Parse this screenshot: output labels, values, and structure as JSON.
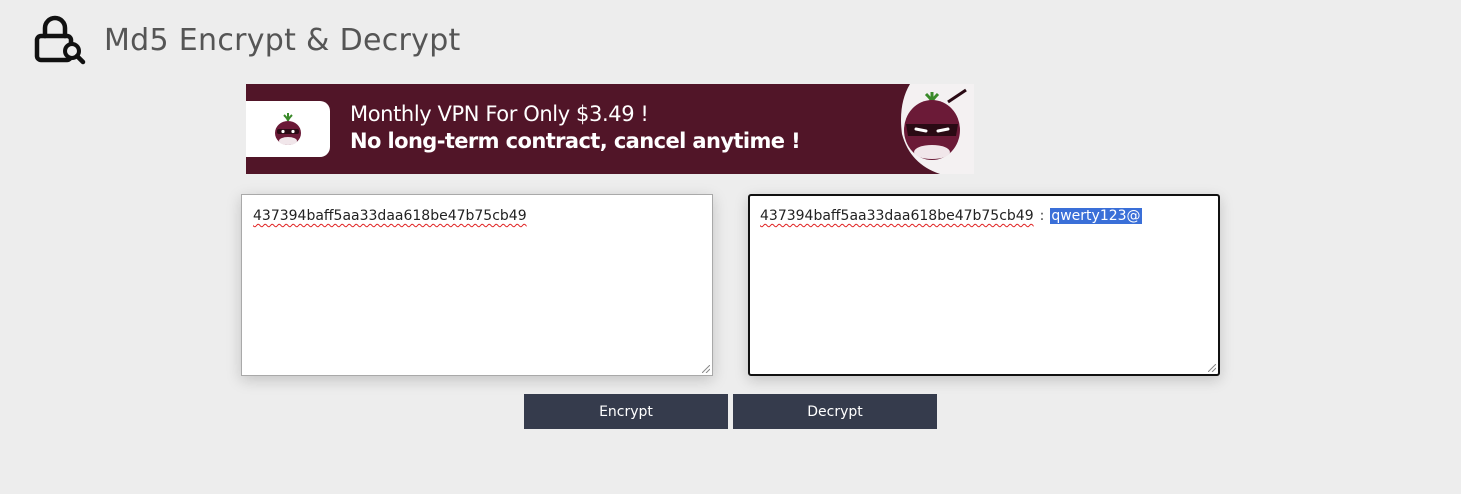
{
  "header": {
    "title": "Md5 Encrypt & Decrypt",
    "logo_icon": "lock-search-icon"
  },
  "banner": {
    "line1": "Monthly VPN For Only $3.49 !",
    "line2": "No long-term contract, cancel anytime !",
    "background": "#511528",
    "mascot_icon": "onion-ninja-icon"
  },
  "input_box": {
    "value": "437394baff5aa33daa618be47b75cb49"
  },
  "output_box": {
    "hash": "437394baff5aa33daa618be47b75cb49",
    "separator": ":",
    "result": "qwerty123@"
  },
  "buttons": {
    "encrypt_label": "Encrypt",
    "decrypt_label": "Decrypt",
    "color": "#353b4c"
  }
}
